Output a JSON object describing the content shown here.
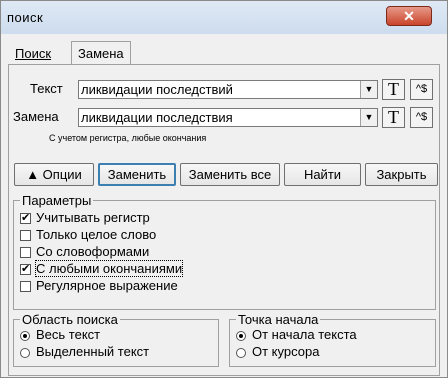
{
  "window": {
    "title": "поиск",
    "close_glyph": "✕"
  },
  "tabs": [
    {
      "label": "Поиск",
      "active": false
    },
    {
      "label": "Замена",
      "active": true
    }
  ],
  "form": {
    "text_label": "Текст",
    "text_value": "ликвидации последствий",
    "replace_label": "Замена",
    "replace_value": "ликвидации последствия",
    "t_button": "T",
    "regex_button": "^$",
    "hint": "С учетом регистра, любые окончания"
  },
  "buttons": {
    "options": "▲ Опции",
    "replace": "Заменить",
    "replace_all": "Заменить все",
    "find": "Найти",
    "close": "Закрыть"
  },
  "params": {
    "legend": "Параметры",
    "items": [
      {
        "label": "Учитывать регистр",
        "checked": true
      },
      {
        "label": "Только целое слово",
        "checked": false
      },
      {
        "label": "Со словоформами",
        "checked": false
      },
      {
        "label": "С любыми окончаниями",
        "checked": true
      },
      {
        "label": "Регулярное выражение",
        "checked": false
      }
    ]
  },
  "scope": {
    "legend": "Область поиска",
    "items": [
      {
        "label": "Весь текст",
        "selected": true
      },
      {
        "label": "Выделенный текст",
        "selected": false
      }
    ]
  },
  "origin": {
    "legend": "Точка начала",
    "items": [
      {
        "label": "От начала текста",
        "selected": true
      },
      {
        "label": "От курсора",
        "selected": false
      }
    ]
  },
  "checkmark": "✔"
}
